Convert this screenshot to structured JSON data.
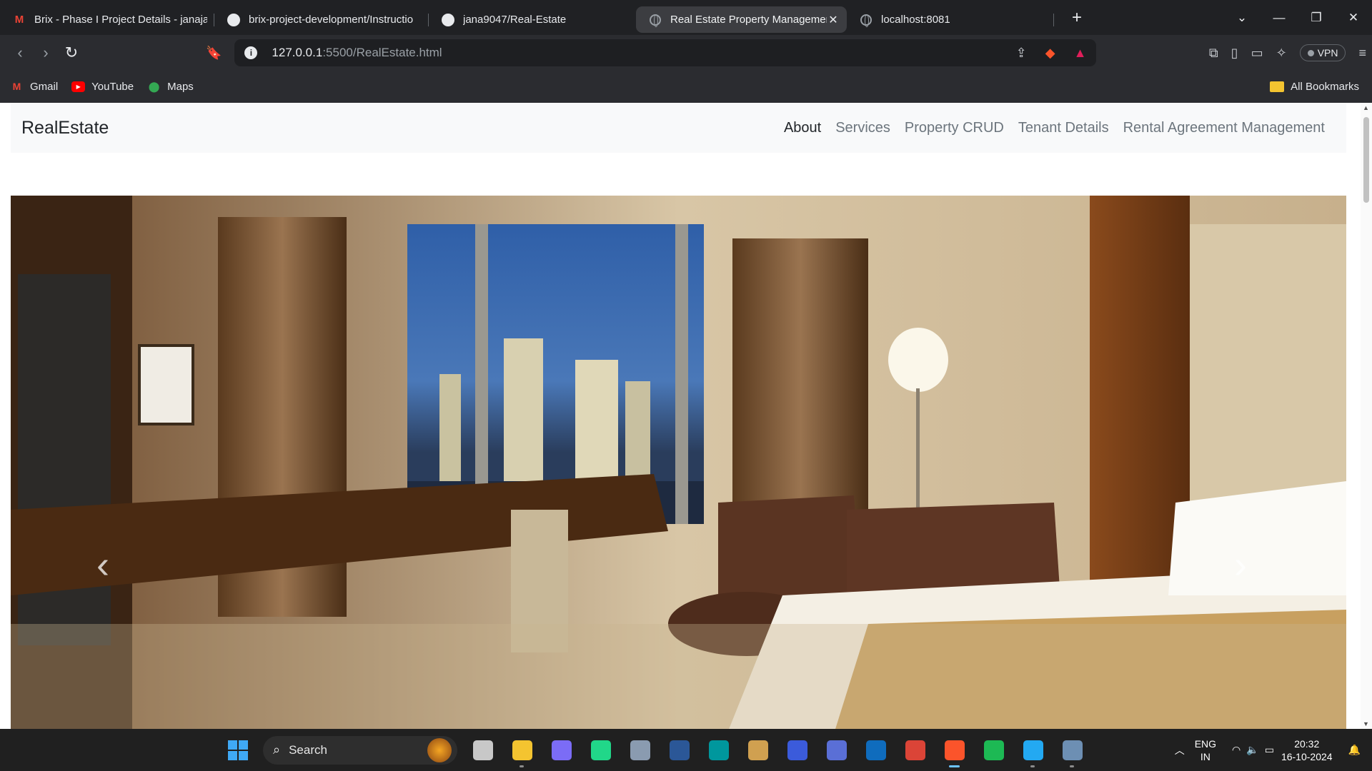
{
  "browser": {
    "tabs": [
      {
        "label": "Brix - Phase I Project Details - janaja",
        "icon": "gmail-icon",
        "active": false
      },
      {
        "label": "brix-project-development/Instructio",
        "icon": "github-icon",
        "active": false
      },
      {
        "label": "jana9047/Real-Estate",
        "icon": "github-icon",
        "active": false
      },
      {
        "label": "Real Estate Property Management",
        "icon": "globe-icon",
        "active": true
      },
      {
        "label": "localhost:8081",
        "icon": "globe-icon",
        "active": false
      }
    ],
    "new_tab": "+",
    "url_host": "127.0.0.1",
    "url_rest": ":5500/RealEstate.html",
    "vpn_label": "VPN",
    "bookmarks": [
      {
        "label": "Gmail",
        "icon": "gmail-icon"
      },
      {
        "label": "YouTube",
        "icon": "youtube-icon"
      },
      {
        "label": "Maps",
        "icon": "maps-icon"
      }
    ],
    "all_bookmarks": "All Bookmarks"
  },
  "site": {
    "brand": "RealEstate",
    "nav": [
      {
        "label": "About",
        "active": true
      },
      {
        "label": "Services",
        "active": false
      },
      {
        "label": "Property CRUD",
        "active": false
      },
      {
        "label": "Tenant Details",
        "active": false
      },
      {
        "label": "Rental Agreement Management",
        "active": false
      }
    ],
    "carousel": {
      "prev": "‹",
      "next": "›"
    }
  },
  "taskbar": {
    "search_label": "Search",
    "language": "ENG",
    "region": "IN",
    "time": "20:32",
    "date": "16-10-2024",
    "apps": [
      {
        "name": "task-view-icon",
        "color": "#c8c8c8",
        "state": ""
      },
      {
        "name": "file-explorer-icon",
        "color": "#f4c430",
        "state": "run"
      },
      {
        "name": "copilot-icon",
        "color": "#7b6cf6",
        "state": ""
      },
      {
        "name": "pycharm-icon",
        "color": "#21d789",
        "state": ""
      },
      {
        "name": "settings-icon",
        "color": "#8a9bb0",
        "state": ""
      },
      {
        "name": "word-icon",
        "color": "#2b5797",
        "state": ""
      },
      {
        "name": "arduino-icon",
        "color": "#00979d",
        "state": ""
      },
      {
        "name": "tools-icon",
        "color": "#d0a050",
        "state": ""
      },
      {
        "name": "mathtype-icon",
        "color": "#3b5bdb",
        "state": ""
      },
      {
        "name": "stack-icon",
        "color": "#5a6fd6",
        "state": ""
      },
      {
        "name": "outlook-icon",
        "color": "#0f6cbd",
        "state": ""
      },
      {
        "name": "chrome-icon",
        "color": "#db4437",
        "state": ""
      },
      {
        "name": "brave-icon",
        "color": "#fb542b",
        "state": "act"
      },
      {
        "name": "spotify-icon",
        "color": "#1db954",
        "state": ""
      },
      {
        "name": "vscode-icon",
        "color": "#23a9f2",
        "state": "run"
      },
      {
        "name": "network-app-icon",
        "color": "#6d8fb3",
        "state": "run"
      }
    ]
  }
}
